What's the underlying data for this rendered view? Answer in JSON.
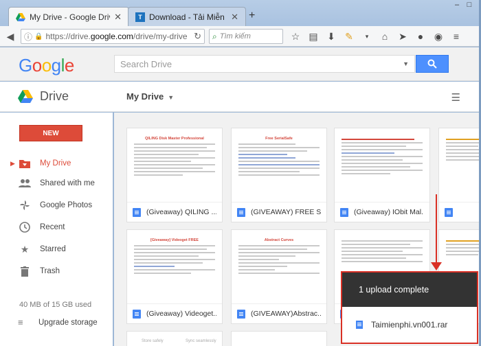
{
  "browser": {
    "tabs": [
      {
        "label": "My Drive - Google Drive",
        "active": true
      },
      {
        "label": "Download - Tải Miễn Phí V...",
        "active": false
      }
    ],
    "url_prefix": "https://drive.",
    "url_domain": "google.com",
    "url_path": "/drive/my-drive",
    "search_placeholder": "Tìm kiếm"
  },
  "header": {
    "logo_letters": [
      "G",
      "o",
      "o",
      "g",
      "l",
      "e"
    ],
    "search_placeholder": "Search Drive"
  },
  "subbar": {
    "app_name": "Drive",
    "location": "My Drive"
  },
  "sidebar": {
    "new_label": "NEW",
    "items": [
      {
        "label": "My Drive",
        "icon": "folder-icon"
      },
      {
        "label": "Shared with me",
        "icon": "people-icon"
      },
      {
        "label": "Google Photos",
        "icon": "pinwheel-icon"
      },
      {
        "label": "Recent",
        "icon": "clock-icon"
      },
      {
        "label": "Starred",
        "icon": "star-icon"
      },
      {
        "label": "Trash",
        "icon": "trash-icon"
      }
    ],
    "storage": "40 MB of 15 GB used",
    "upgrade": "Upgrade storage"
  },
  "files": {
    "row1": [
      {
        "name": "(Giveaway) QILING ...",
        "thumb_title": "QILING Disk Master Professional"
      },
      {
        "name": "(GIVEAWAY) FREE S...",
        "thumb_title": "Free SerialSafe"
      },
      {
        "name": "(Giveaway) IObit Mal...",
        "thumb_title": ""
      },
      {
        "name": "",
        "thumb_title": ""
      }
    ],
    "row2": [
      {
        "name": "(Giveaway) Videoget...",
        "thumb_title": "[Giveaway] Videoget FREE"
      },
      {
        "name": "(GIVEAWAY)Abstrac...",
        "thumb_title": "Abstract Curves"
      },
      {
        "name": "",
        "thumb_title": ""
      },
      {
        "name": "",
        "thumb_title": ""
      }
    ],
    "row3_labels": [
      "Store safely",
      "Sync seamlessly"
    ]
  },
  "upload": {
    "status": "1 upload complete",
    "file": "Taimienphi.vn001.rar"
  },
  "colors": {
    "accent_red": "#dd4b39",
    "search_blue": "#4d90fe",
    "highlight_red": "#d93025"
  }
}
